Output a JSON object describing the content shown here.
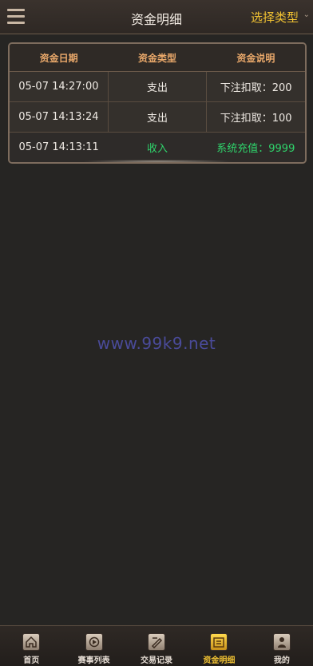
{
  "header": {
    "title": "资金明细",
    "type_select": "选择类型"
  },
  "table": {
    "columns": [
      "资金日期",
      "资金类型",
      "资金说明"
    ],
    "rows": [
      {
        "date": "05-07 14:27:00",
        "type": "支出",
        "desc": "下注扣取：200"
      },
      {
        "date": "05-07 14:13:24",
        "type": "支出",
        "desc": "下注扣取：100"
      },
      {
        "date": "05-07 14:13:11",
        "type": "收入",
        "desc": "系统充值：9999"
      }
    ]
  },
  "watermark": "www.99k9.net",
  "tabs": [
    {
      "label": "首页",
      "icon": "home-icon"
    },
    {
      "label": "赛事列表",
      "icon": "event-list-icon"
    },
    {
      "label": "交易记录",
      "icon": "trade-record-icon"
    },
    {
      "label": "资金明细",
      "icon": "funds-detail-icon",
      "active": true
    },
    {
      "label": "我的",
      "icon": "user-icon"
    }
  ],
  "colors": {
    "accent": "#f1c232",
    "income": "#2fd36b",
    "header_text": "#e9a86a"
  }
}
